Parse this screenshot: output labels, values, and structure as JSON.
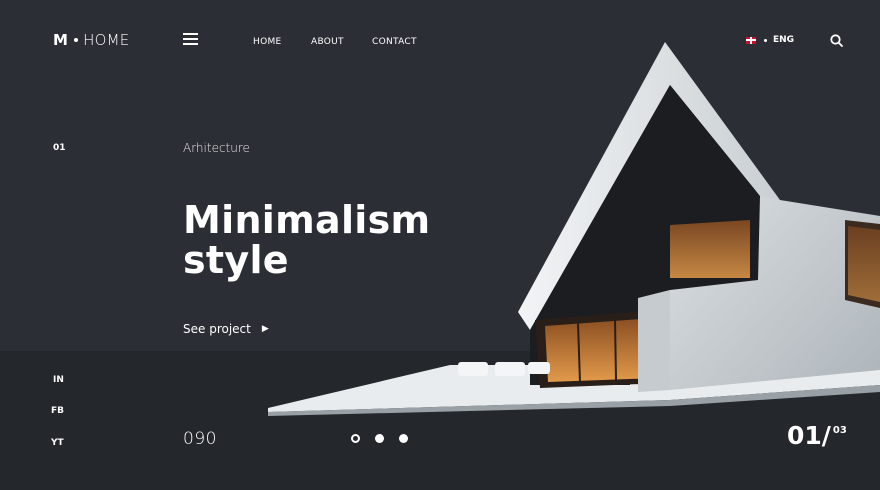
{
  "header": {
    "logo_letter": "M",
    "logo_word": "HOME",
    "nav": [
      {
        "label": "HOME"
      },
      {
        "label": "ABOUT"
      },
      {
        "label": "CONTACT"
      }
    ],
    "language": "ENG",
    "icons": [
      "menu-icon",
      "uk-flag-icon",
      "search-icon"
    ]
  },
  "hero": {
    "slide_number": "01",
    "category": "Arhitecture",
    "title_line1": "Minimalism",
    "title_line2": "style",
    "cta": "See project",
    "cta_icon": "play-arrow-icon"
  },
  "social": [
    {
      "label": "IN"
    },
    {
      "label": "FB"
    },
    {
      "label": "YT"
    }
  ],
  "footer": {
    "counter": "090",
    "current_page": "01/",
    "total_pages": "03",
    "slider_dots": 3,
    "active_dot": 1
  },
  "colors": {
    "background": "#2b2e35",
    "bottom_band": "#24272c",
    "text": "#ffffff",
    "window_glow": "#d68a3c"
  }
}
